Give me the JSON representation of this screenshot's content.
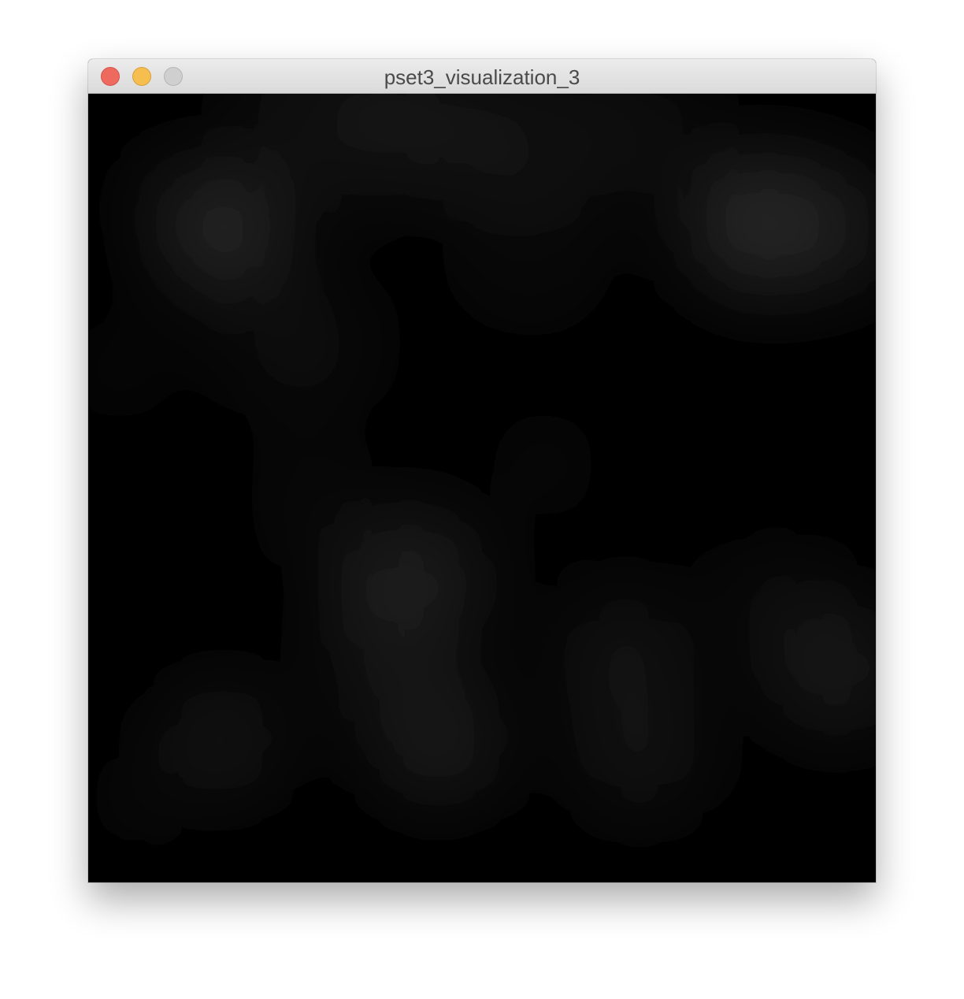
{
  "window": {
    "title": "pset3_visualization_3"
  },
  "controls": {
    "close": "close-icon",
    "minimize": "minimize-icon",
    "zoom": "zoom-icon"
  },
  "colors": {
    "close": "#ee6a5f",
    "minimize": "#f5be4f",
    "zoom_disabled": "#cfcfcf",
    "canvas_background": "#000000",
    "blob_color": "#2e2e2e"
  }
}
